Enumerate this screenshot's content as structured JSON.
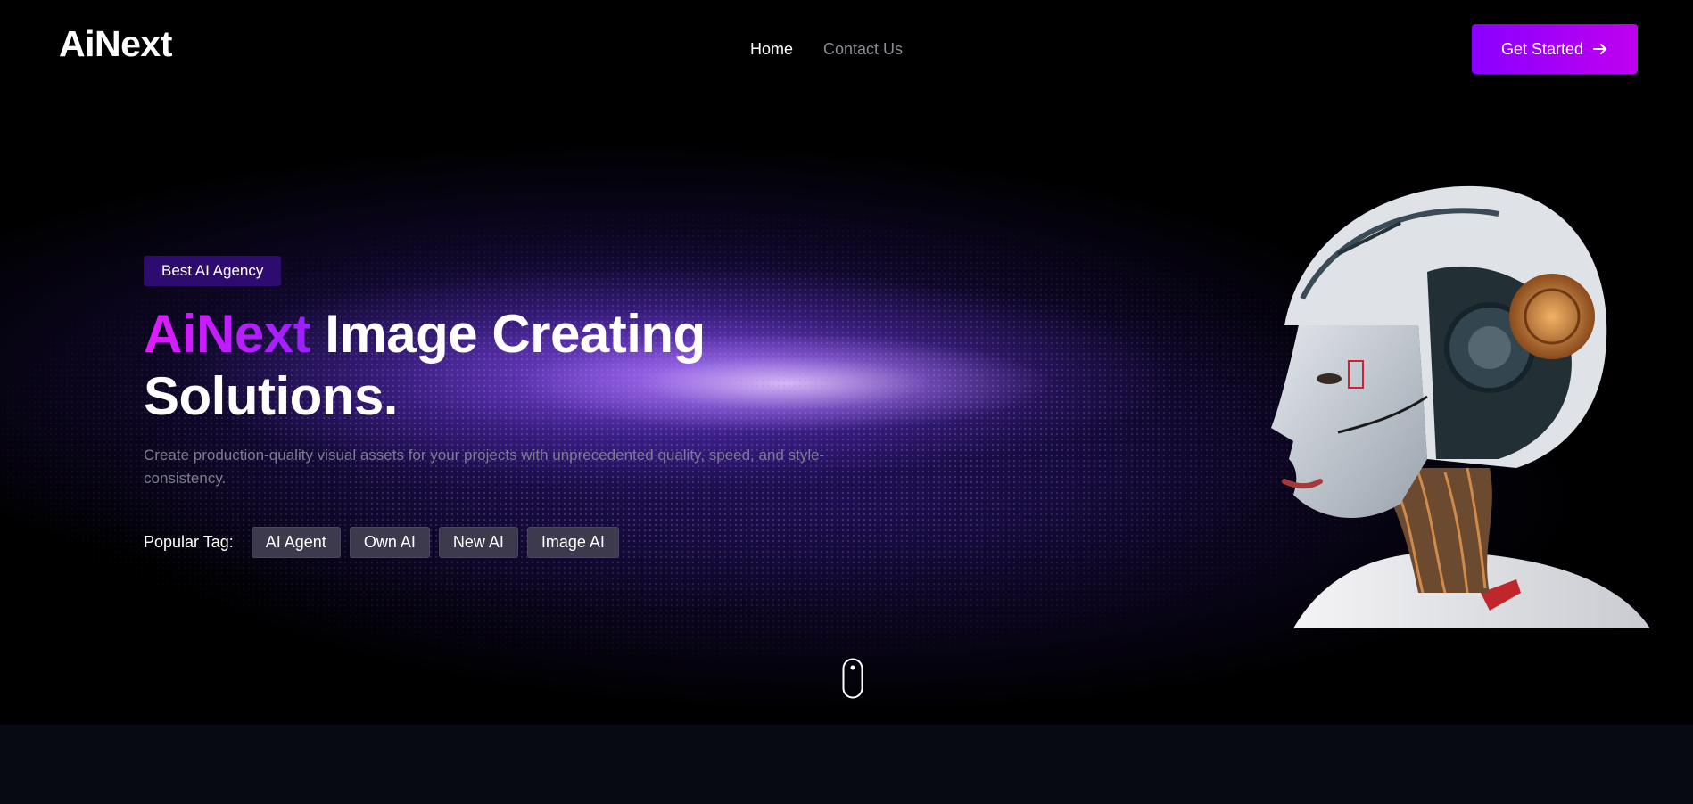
{
  "header": {
    "logo": "AiNext",
    "nav": [
      {
        "label": "Home"
      },
      {
        "label": "Contact Us"
      }
    ],
    "cta_label": "Get Started"
  },
  "hero": {
    "badge": "Best AI Agency",
    "headline_brand": "AiNext",
    "headline_line1_rest": "Image Creating",
    "headline_line2": "Solutions.",
    "subtext": "Create production-quality visual assets for your projects with unprecedented quality, speed, and style-consistency.",
    "tags_label": "Popular Tag:",
    "tags": [
      {
        "label": "AI Agent"
      },
      {
        "label": "Own AI"
      },
      {
        "label": "New AI"
      },
      {
        "label": "Image AI"
      }
    ]
  },
  "icons": {
    "cta": "arrow-right-icon",
    "scroll": "mouse-scroll-icon"
  },
  "colors": {
    "accent_start": "#8a00ff",
    "accent_end": "#c000f0",
    "brand_text_start": "#e11bff",
    "brand_text_end": "#9b20ff",
    "badge_bg": "#2e0b6e",
    "tag_bg": "#3d3a4d",
    "subtext": "#7d7d8e",
    "page_bg": "#000000"
  }
}
